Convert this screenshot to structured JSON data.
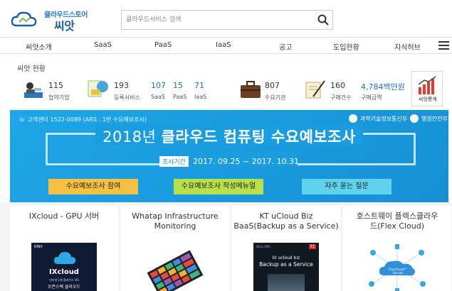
{
  "header": {
    "logo_small": "클라우드스토어",
    "logo_big": "씨앗",
    "search_placeholder": "클라우드서비스 검색"
  },
  "nav": {
    "items": [
      "씨앗소개",
      "SaaS",
      "PaaS",
      "IaaS",
      "공고",
      "도입현황",
      "지식허브"
    ]
  },
  "stats": {
    "title": "씨앗 현황",
    "partners": {
      "value": "115",
      "label": "협약기업"
    },
    "services": {
      "value": "193",
      "label": "등록서비스"
    },
    "saas": {
      "value": "107",
      "label": "SaaS"
    },
    "paas": {
      "value": "15",
      "label": "PaaS"
    },
    "iaas": {
      "value": "71",
      "label": "IaaS"
    },
    "orgs": {
      "value": "807",
      "label": "수요기관"
    },
    "purchases": {
      "value": "160",
      "label": "구매건수"
    },
    "amount": {
      "value": "4,784백만원",
      "label": "구매금액"
    },
    "stats_link": "씨앗통계"
  },
  "banner": {
    "callcenter": "☏ 고객센터 1522-0089 (ARS : 1번 수요예보조사)",
    "ministry1": "과학기술정보통신부",
    "ministry2": "행정안전부",
    "headline_year": "2018년",
    "headline_rest": "클라우드 컴퓨팅 수요예보조사",
    "period_tag": "조사기간",
    "period_text": "2017. 09.25 ~ 2017. 10.31",
    "btn_survey": "수요예보조사 참여",
    "btn_manual": "수요예보조사 작성메뉴얼",
    "btn_faq": "자주 묻는 질문"
  },
  "cards": [
    {
      "title_line1": "IXcloud - GPU 서버",
      "title_line2": ""
    },
    {
      "title_line1": "Whatap Infrastructure",
      "title_line2": "Monitoring"
    },
    {
      "title_line1": "KT uCloud Biz",
      "title_line2": "BaaS(Backup as a Service)"
    },
    {
      "title_line1": "호스트웨이 플렉스클라우",
      "title_line2": "드(Flex Cloud)"
    }
  ],
  "card_images": {
    "ixcloud_brand": "KINX",
    "ixcloud_title": "IXcloud",
    "ixcloud_sub1": "인터넷 1위 클라우드 OS",
    "ixcloud_sub2": "오픈스택 클라우드",
    "kt_brand": "DELL EMC",
    "kt_line1": "kt ucloud biz",
    "kt_line2": "Backup as a Service",
    "flex_label": "FlexCloud™ Server"
  },
  "colors": {
    "banner": "#1a9de0",
    "btn_orange": "#f5c142",
    "btn_green": "#b7e04a",
    "btn_cyan": "#5fd2ec",
    "link_blue": "#1c72c0"
  }
}
